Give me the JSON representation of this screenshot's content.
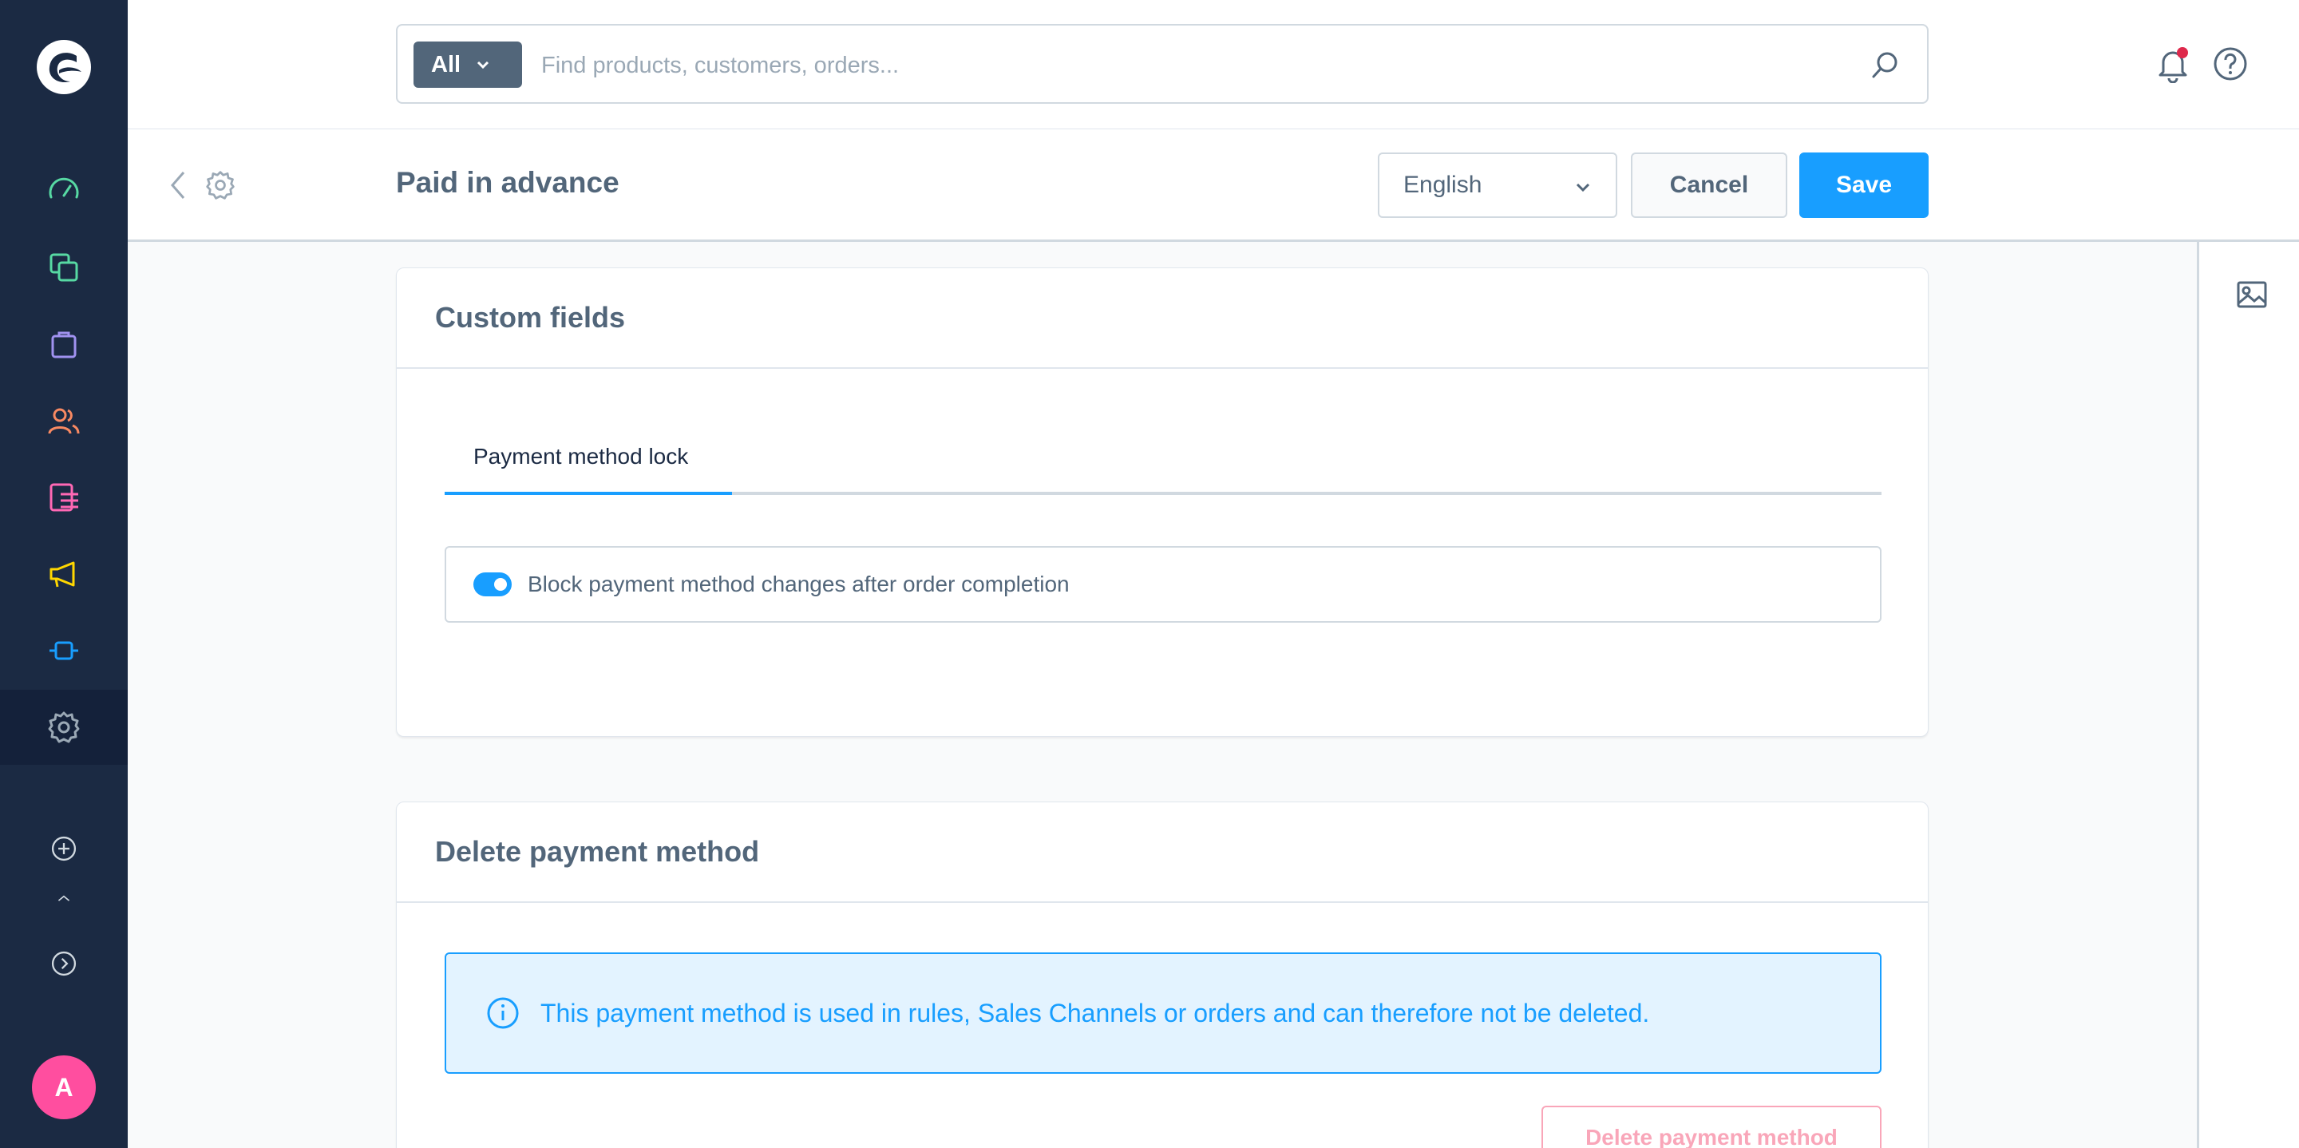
{
  "search": {
    "type_label": "All",
    "placeholder": "Find products, customers, orders..."
  },
  "header": {
    "title": "Paid in advance",
    "language": "English",
    "cancel_label": "Cancel",
    "save_label": "Save"
  },
  "sidebar": {
    "items": [
      {
        "name": "dashboard",
        "icon": "dashboard-icon",
        "color": "#57d9a3"
      },
      {
        "name": "catalogues",
        "icon": "catalogue-icon",
        "color": "#57d9a3"
      },
      {
        "name": "orders",
        "icon": "orders-icon",
        "color": "#a092f0"
      },
      {
        "name": "customers",
        "icon": "customers-icon",
        "color": "#f88962"
      },
      {
        "name": "content",
        "icon": "content-icon",
        "color": "#ff68b4"
      },
      {
        "name": "marketing",
        "icon": "marketing-icon",
        "color": "#ffd700"
      },
      {
        "name": "extensions",
        "icon": "extensions-icon",
        "color": "#189eff"
      },
      {
        "name": "settings",
        "icon": "settings-icon",
        "color": "#9aa8b5"
      }
    ],
    "avatar_letter": "A"
  },
  "custom_fields": {
    "title": "Custom fields",
    "tab_label": "Payment method lock",
    "toggle_label": "Block payment method changes after order completion",
    "toggle_on": true
  },
  "delete_section": {
    "title": "Delete payment method",
    "alert_text": "This payment method is used in rules, Sales Channels or orders and can therefore not be deleted.",
    "delete_label": "Delete payment method"
  },
  "colors": {
    "accent": "#189eff",
    "sidebar_bg": "#1b2a43",
    "danger": "#f9a6b9",
    "notification_dot": "#de294c"
  }
}
